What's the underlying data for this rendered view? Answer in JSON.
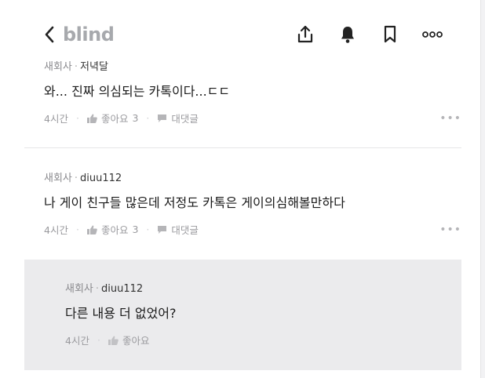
{
  "header": {
    "logo": "blind",
    "icons": [
      "back-chevron-icon",
      "share-icon",
      "bell-icon",
      "bookmark-icon",
      "more-icon"
    ]
  },
  "comments": [
    {
      "company": "새회사",
      "author": "저녁달",
      "text": "와... 진짜 의심되는 카톡이다...ㄷㄷ",
      "time": "4시간",
      "like_label": "좋아요",
      "like_count": "3",
      "reply_label": "대댓글"
    },
    {
      "company": "새회사",
      "author": "diuu112",
      "text": "나 게이 친구들 많은데 저정도 카톡은 게이의심해볼만하다",
      "time": "4시간",
      "like_label": "좋아요",
      "like_count": "3",
      "reply_label": "대댓글"
    }
  ],
  "reply": {
    "company": "새회사",
    "author": "diuu112",
    "text": "다른 내용 더 없었어?",
    "time": "4시간",
    "like_label": "좋아요"
  },
  "colors": {
    "logo": "#a7a9ad",
    "reply_bg": "#ebebed",
    "muted": "#9a9a9e"
  }
}
